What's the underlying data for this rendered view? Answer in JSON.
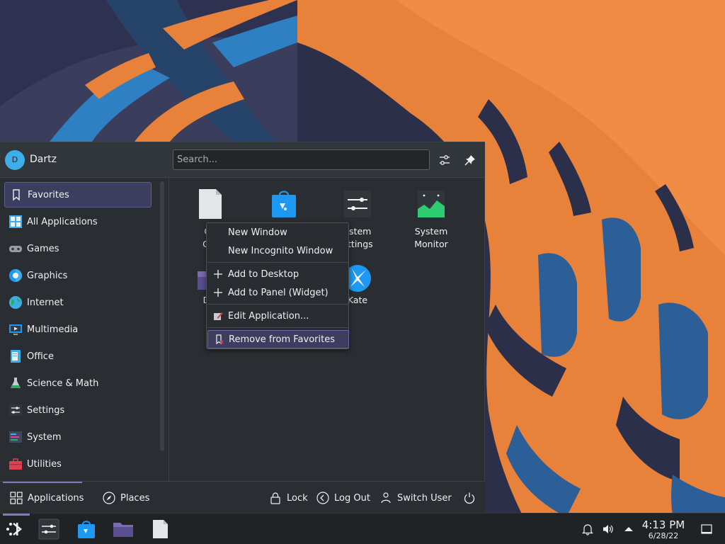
{
  "user": {
    "initial": "D",
    "name": "Dartz"
  },
  "search": {
    "placeholder": "Search..."
  },
  "header_icons": [
    "configure-icon",
    "pin-icon"
  ],
  "sidebar": {
    "items": [
      {
        "label": "Favorites",
        "icon": "bookmark-icon",
        "active": true
      },
      {
        "label": "All Applications",
        "icon": "grid-icon"
      },
      {
        "label": "Games",
        "icon": "gamepad-icon"
      },
      {
        "label": "Graphics",
        "icon": "graphics-icon"
      },
      {
        "label": "Internet",
        "icon": "globe-icon"
      },
      {
        "label": "Multimedia",
        "icon": "multimedia-icon"
      },
      {
        "label": "Office",
        "icon": "office-icon"
      },
      {
        "label": "Science & Math",
        "icon": "flask-icon"
      },
      {
        "label": "Settings",
        "icon": "settings-icon"
      },
      {
        "label": "System",
        "icon": "system-icon"
      },
      {
        "label": "Utilities",
        "icon": "toolbox-icon"
      }
    ]
  },
  "favorites": {
    "items": [
      {
        "label_line1": "Go",
        "label_line2": "Chr",
        "icon": "document-icon"
      },
      {
        "label_line1": "",
        "label_line2": "",
        "icon": "discover-icon"
      },
      {
        "label_line1": "ystem",
        "label_line2": "ettings",
        "icon": "system-settings-icon"
      },
      {
        "label_line1": "System",
        "label_line2": "Monitor",
        "icon": "system-monitor-icon"
      },
      {
        "label_line1": "Dol",
        "label_line2": "",
        "icon": "dolphin-icon"
      },
      {
        "label_line1": "Kate",
        "label_line2": "",
        "icon": "kate-icon"
      }
    ]
  },
  "context_menu": {
    "items": [
      {
        "label": "New Window",
        "icon": ""
      },
      {
        "label": "New Incognito Window",
        "icon": ""
      },
      {
        "label": "Add to Desktop",
        "icon": "plus-icon"
      },
      {
        "label": "Add to Panel (Widget)",
        "icon": "plus-icon"
      },
      {
        "label": "Edit Application...",
        "icon": "edit-icon"
      },
      {
        "label": "Remove from Favorites",
        "icon": "remove-icon",
        "hover": true
      }
    ]
  },
  "footer": {
    "applications": "Applications",
    "places": "Places",
    "lock": "Lock",
    "logout": "Log Out",
    "switch_user": "Switch User"
  },
  "taskbar": {
    "apps": [
      "launcher-icon",
      "system-settings-icon",
      "discover-icon",
      "folder-icon",
      "document-icon"
    ],
    "tray": [
      "bell-icon",
      "volume-icon",
      "expand-up-icon"
    ],
    "time": "4:13 PM",
    "date": "6/28/22"
  },
  "colors": {
    "accent": "#8a74c6",
    "selection": "#3b3e5e",
    "panel": "#2a2e32",
    "taskbar": "#202326",
    "wallpaper_orange": "#e8813a",
    "wallpaper_blue": "#2f7fc3"
  }
}
